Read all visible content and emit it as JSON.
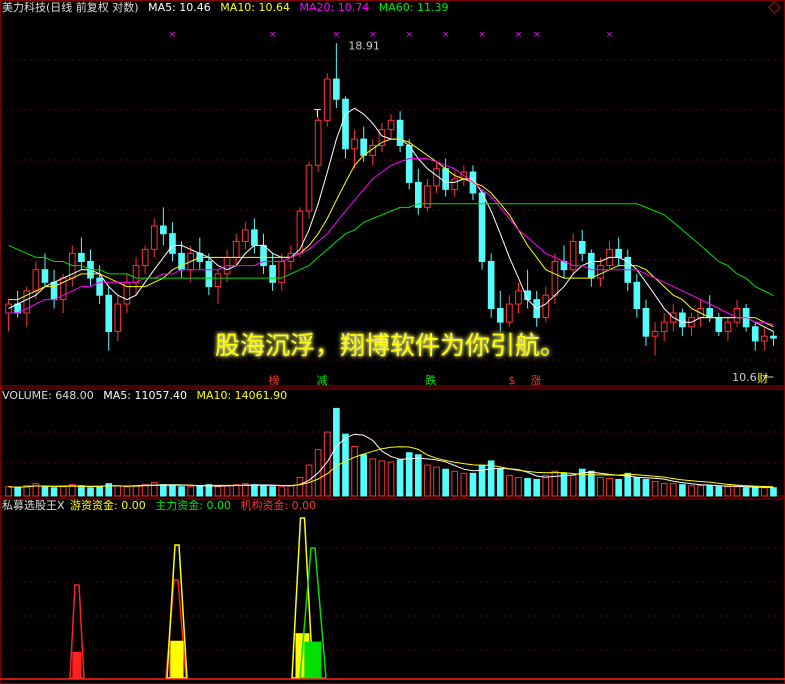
{
  "stock": "美力科技(日线 前复权 对数)",
  "price_header": {
    "ma5": "MA5: 10.46",
    "ma10": "MA10: 10.64",
    "ma20": "MA20: 10.74",
    "ma60": "MA60: 11.39"
  },
  "volume_header": {
    "volume": "VOLUME: 648.00",
    "ma5": "MA5: 11057.40",
    "ma10": "MA10: 14061.90"
  },
  "indicator_header": {
    "name": "私募选股王X",
    "youzi": "游资资金: 0.00",
    "zhuli": "主力资金: 0.00",
    "jigou": "机构资金: 0.00"
  },
  "slogan": "股海沉浮，翔博软件为你引航。",
  "annotations": {
    "high": "18.91",
    "low": "10.6",
    "signal_marks": [
      "榜",
      "减",
      "跌",
      "$",
      "涨"
    ],
    "cai": "财",
    "t": "T"
  },
  "colors": {
    "up": "#ff3232",
    "down": "#54fcfc",
    "ma5": "#ffffff",
    "ma10": "#ffff00",
    "ma20": "#ff00ff",
    "ma60": "#00e000"
  },
  "chart_data": {
    "type": "candlestick",
    "y_scale": "log",
    "ylim": [
      9.5,
      19.5
    ],
    "candles": [
      [
        11.0,
        11.3,
        10.6,
        11.2
      ],
      [
        11.2,
        11.5,
        10.9,
        11.0
      ],
      [
        11.0,
        11.6,
        10.7,
        11.5
      ],
      [
        11.5,
        12.2,
        11.3,
        12.0
      ],
      [
        12.0,
        12.4,
        11.6,
        11.7
      ],
      [
        11.7,
        12.0,
        11.1,
        11.3
      ],
      [
        11.3,
        11.9,
        11.0,
        11.8
      ],
      [
        11.8,
        12.6,
        11.6,
        12.4
      ],
      [
        12.4,
        12.8,
        12.0,
        12.2
      ],
      [
        12.2,
        12.5,
        11.6,
        11.8
      ],
      [
        11.8,
        12.1,
        11.2,
        11.4
      ],
      [
        11.4,
        11.6,
        10.2,
        10.6
      ],
      [
        10.6,
        11.4,
        10.4,
        11.2
      ],
      [
        11.2,
        11.9,
        11.0,
        11.7
      ],
      [
        11.7,
        12.3,
        11.4,
        12.1
      ],
      [
        12.1,
        12.6,
        11.9,
        12.5
      ],
      [
        12.5,
        13.3,
        12.3,
        13.1
      ],
      [
        13.1,
        13.6,
        12.6,
        12.9
      ],
      [
        12.9,
        13.2,
        12.2,
        12.4
      ],
      [
        12.4,
        12.7,
        11.8,
        12.0
      ],
      [
        12.0,
        12.6,
        11.7,
        12.4
      ],
      [
        12.4,
        12.8,
        12.0,
        12.2
      ],
      [
        12.2,
        12.4,
        11.4,
        11.6
      ],
      [
        11.6,
        12.0,
        11.2,
        11.9
      ],
      [
        11.9,
        12.5,
        11.7,
        12.3
      ],
      [
        12.3,
        12.9,
        12.1,
        12.7
      ],
      [
        12.7,
        13.2,
        12.5,
        13.0
      ],
      [
        13.0,
        13.3,
        12.4,
        12.6
      ],
      [
        12.6,
        12.9,
        11.9,
        12.1
      ],
      [
        12.1,
        12.4,
        11.5,
        11.7
      ],
      [
        11.7,
        12.4,
        11.5,
        12.2
      ],
      [
        12.2,
        12.6,
        12.0,
        12.4
      ],
      [
        12.4,
        13.6,
        12.3,
        13.5
      ],
      [
        13.5,
        14.9,
        13.3,
        14.8
      ],
      [
        14.8,
        16.3,
        14.6,
        16.2
      ],
      [
        16.2,
        17.8,
        16.0,
        17.6
      ],
      [
        17.6,
        18.91,
        16.6,
        16.9
      ],
      [
        16.9,
        17.0,
        15.0,
        15.3
      ],
      [
        15.3,
        15.9,
        14.7,
        15.6
      ],
      [
        15.6,
        16.0,
        14.9,
        15.1
      ],
      [
        15.1,
        15.6,
        14.8,
        15.4
      ],
      [
        15.4,
        16.1,
        15.2,
        15.9
      ],
      [
        15.9,
        16.4,
        15.6,
        16.2
      ],
      [
        16.2,
        16.5,
        15.2,
        15.4
      ],
      [
        15.4,
        15.6,
        14.1,
        14.3
      ],
      [
        14.3,
        14.7,
        13.4,
        13.6
      ],
      [
        13.6,
        14.4,
        13.5,
        14.2
      ],
      [
        14.2,
        14.9,
        14.0,
        14.7
      ],
      [
        14.7,
        15.0,
        13.9,
        14.1
      ],
      [
        14.1,
        14.6,
        13.9,
        14.4
      ],
      [
        14.4,
        14.8,
        14.2,
        14.6
      ],
      [
        14.6,
        14.8,
        13.8,
        14.0
      ],
      [
        14.0,
        14.1,
        12.0,
        12.2
      ],
      [
        12.2,
        12.4,
        10.9,
        11.1
      ],
      [
        11.1,
        11.5,
        10.6,
        10.8
      ],
      [
        10.8,
        11.4,
        10.7,
        11.2
      ],
      [
        11.2,
        11.7,
        11.0,
        11.5
      ],
      [
        11.5,
        12.0,
        11.1,
        11.3
      ],
      [
        11.3,
        11.5,
        10.7,
        10.9
      ],
      [
        10.9,
        11.6,
        10.8,
        11.4
      ],
      [
        11.4,
        12.4,
        11.2,
        12.2
      ],
      [
        12.2,
        12.6,
        11.8,
        12.0
      ],
      [
        12.0,
        12.9,
        11.9,
        12.7
      ],
      [
        12.7,
        13.0,
        12.2,
        12.4
      ],
      [
        12.4,
        12.5,
        11.6,
        11.8
      ],
      [
        11.8,
        12.3,
        11.6,
        12.1
      ],
      [
        12.1,
        12.7,
        12.0,
        12.5
      ],
      [
        12.5,
        12.8,
        12.1,
        12.3
      ],
      [
        12.3,
        12.5,
        11.5,
        11.7
      ],
      [
        11.7,
        11.9,
        10.9,
        11.1
      ],
      [
        11.1,
        11.3,
        10.3,
        10.5
      ],
      [
        10.5,
        10.8,
        10.1,
        10.6
      ],
      [
        10.6,
        11.0,
        10.4,
        10.8
      ],
      [
        10.8,
        11.2,
        10.6,
        11.0
      ],
      [
        11.0,
        11.1,
        10.5,
        10.7
      ],
      [
        10.7,
        11.0,
        10.5,
        10.9
      ],
      [
        10.9,
        11.3,
        10.7,
        11.1
      ],
      [
        11.1,
        11.4,
        10.8,
        10.9
      ],
      [
        10.9,
        11.0,
        10.5,
        10.6
      ],
      [
        10.6,
        10.9,
        10.4,
        10.8
      ],
      [
        10.8,
        11.3,
        10.7,
        11.1
      ],
      [
        11.1,
        11.2,
        10.6,
        10.7
      ],
      [
        10.7,
        10.8,
        10.2,
        10.4
      ],
      [
        10.4,
        10.7,
        10.2,
        10.5
      ],
      [
        10.5,
        10.6,
        10.3,
        10.46
      ]
    ],
    "ma_levels": {
      "ma5": [
        11.1,
        11.2,
        11.3,
        11.4,
        11.6,
        11.7,
        11.8,
        11.9,
        12.0,
        12.0,
        11.9,
        11.6,
        11.4,
        11.3,
        11.4,
        11.7,
        12.0,
        12.3,
        12.6,
        12.6,
        12.5,
        12.4,
        12.3,
        12.1,
        12.0,
        12.1,
        12.4,
        12.6,
        12.6,
        12.4,
        12.3,
        12.3,
        12.5,
        13.0,
        13.7,
        14.6,
        15.6,
        16.4,
        16.6,
        16.4,
        16.1,
        15.7,
        15.6,
        15.6,
        15.4,
        15.0,
        14.7,
        14.5,
        14.3,
        14.3,
        14.4,
        14.4,
        14.0,
        13.5,
        12.9,
        12.3,
        11.8,
        11.3,
        11.1,
        11.2,
        11.4,
        11.6,
        11.9,
        12.1,
        12.2,
        12.2,
        12.3,
        12.3,
        12.2,
        12.0,
        11.7,
        11.4,
        11.1,
        10.9,
        10.8,
        10.8,
        10.9,
        10.9,
        10.9,
        10.9,
        10.9,
        10.9,
        10.8,
        10.7,
        10.6
      ],
      "ma10": [
        11.3,
        11.3,
        11.4,
        11.5,
        11.6,
        11.6,
        11.7,
        11.8,
        11.9,
        11.9,
        11.9,
        11.8,
        11.7,
        11.6,
        11.6,
        11.6,
        11.7,
        11.8,
        12.0,
        12.1,
        12.2,
        12.3,
        12.3,
        12.3,
        12.3,
        12.3,
        12.3,
        12.3,
        12.3,
        12.3,
        12.3,
        12.3,
        12.4,
        12.6,
        12.9,
        13.3,
        13.8,
        14.3,
        14.8,
        15.1,
        15.3,
        15.5,
        15.6,
        15.6,
        15.5,
        15.3,
        15.1,
        14.9,
        14.7,
        14.5,
        14.4,
        14.3,
        14.2,
        14.0,
        13.7,
        13.4,
        13.0,
        12.6,
        12.3,
        12.0,
        11.9,
        11.8,
        11.8,
        11.8,
        11.8,
        11.9,
        12.0,
        12.1,
        12.1,
        12.1,
        12.0,
        11.8,
        11.6,
        11.4,
        11.3,
        11.1,
        11.0,
        10.9,
        10.9,
        10.9,
        10.9,
        10.9,
        10.9,
        10.8,
        10.7
      ],
      "ma20": [
        11.0,
        11.0,
        11.1,
        11.2,
        11.3,
        11.3,
        11.4,
        11.5,
        11.6,
        11.6,
        11.7,
        11.7,
        11.7,
        11.7,
        11.7,
        11.8,
        11.8,
        11.9,
        11.9,
        12.0,
        12.0,
        12.0,
        12.0,
        12.0,
        12.1,
        12.1,
        12.1,
        12.1,
        12.2,
        12.2,
        12.2,
        12.3,
        12.4,
        12.5,
        12.7,
        12.9,
        13.2,
        13.5,
        13.8,
        14.1,
        14.4,
        14.6,
        14.8,
        14.9,
        15.0,
        15.0,
        15.0,
        14.9,
        14.8,
        14.7,
        14.5,
        14.3,
        14.1,
        13.9,
        13.6,
        13.3,
        13.0,
        12.8,
        12.6,
        12.4,
        12.3,
        12.2,
        12.1,
        12.1,
        12.0,
        12.0,
        12.0,
        12.0,
        12.0,
        12.0,
        11.9,
        11.8,
        11.7,
        11.6,
        11.5,
        11.4,
        11.3,
        11.2,
        11.1,
        11.0,
        10.9,
        10.9,
        10.8,
        10.8,
        10.74
      ],
      "ma60": [
        12.6,
        12.5,
        12.4,
        12.3,
        12.3,
        12.2,
        12.2,
        12.1,
        12.1,
        12.0,
        12.0,
        11.9,
        11.9,
        11.9,
        11.8,
        11.8,
        11.8,
        11.8,
        11.8,
        11.8,
        11.8,
        11.8,
        11.8,
        11.8,
        11.8,
        11.8,
        11.8,
        11.8,
        11.8,
        11.8,
        11.8,
        11.9,
        12.0,
        12.1,
        12.3,
        12.5,
        12.7,
        12.9,
        13.0,
        13.2,
        13.3,
        13.4,
        13.5,
        13.6,
        13.6,
        13.7,
        13.7,
        13.7,
        13.7,
        13.7,
        13.7,
        13.7,
        13.7,
        13.7,
        13.7,
        13.7,
        13.7,
        13.7,
        13.7,
        13.7,
        13.7,
        13.7,
        13.7,
        13.7,
        13.7,
        13.7,
        13.7,
        13.7,
        13.7,
        13.7,
        13.6,
        13.5,
        13.4,
        13.2,
        13.0,
        12.8,
        12.6,
        12.4,
        12.2,
        12.1,
        11.9,
        11.8,
        11.6,
        11.5,
        11.39
      ]
    },
    "volume": [
      9,
      8,
      10,
      12,
      9,
      8,
      9,
      11,
      10,
      8,
      9,
      12,
      10,
      9,
      10,
      11,
      13,
      11,
      10,
      9,
      9,
      10,
      11,
      9,
      10,
      11,
      12,
      11,
      10,
      9,
      9,
      10,
      18,
      30,
      45,
      62,
      85,
      60,
      48,
      40,
      36,
      34,
      33,
      35,
      42,
      40,
      30,
      28,
      26,
      24,
      22,
      22,
      30,
      34,
      26,
      20,
      18,
      17,
      16,
      20,
      24,
      22,
      20,
      26,
      24,
      18,
      17,
      16,
      22,
      18,
      16,
      14,
      12,
      12,
      11,
      10,
      10,
      10,
      9,
      9,
      9,
      8,
      8,
      8,
      8
    ],
    "indicator": {
      "red": [
        [
          70,
          95
        ],
        [
          166,
          180
        ],
        [
          292,
          300
        ]
      ],
      "yellow": [
        [
          166,
          187
        ],
        [
          292,
          312
        ]
      ],
      "green": [
        [
          300,
          326
        ]
      ]
    }
  }
}
